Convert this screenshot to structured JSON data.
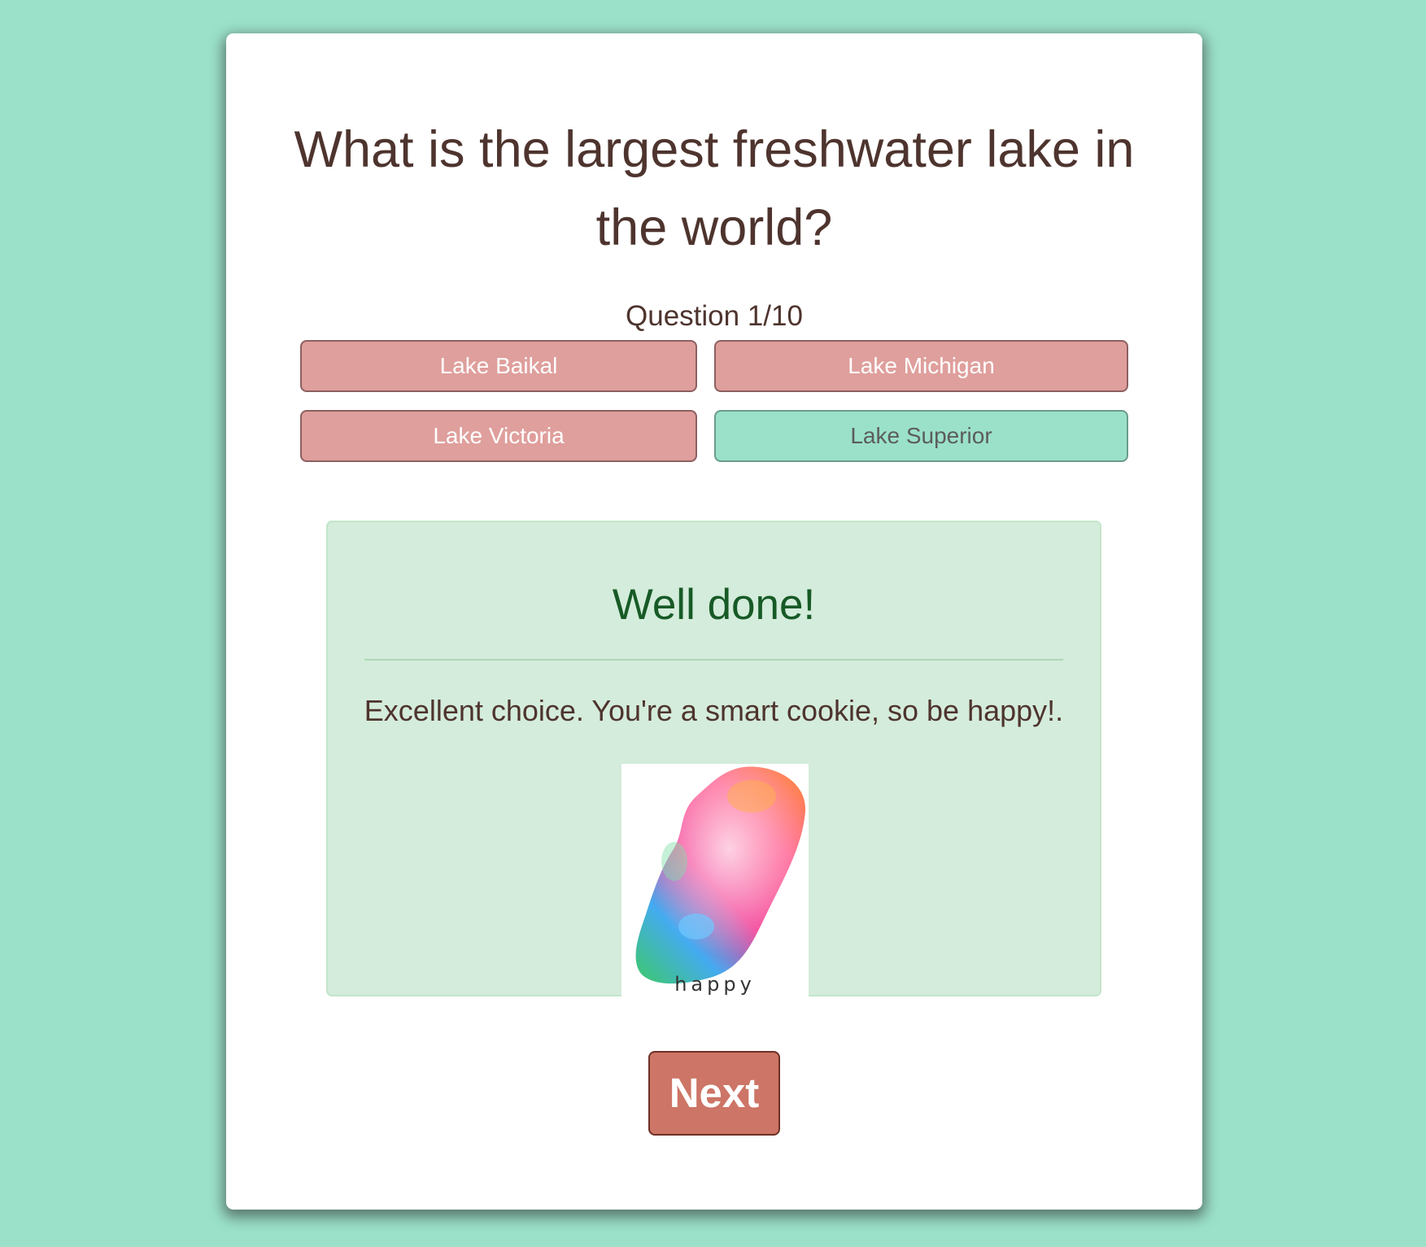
{
  "quiz": {
    "question": "What is the largest freshwater lake in the world?",
    "counter": "Question 1/10",
    "answers": [
      {
        "label": "Lake Baikal",
        "state": "incorrect"
      },
      {
        "label": "Lake Michigan",
        "state": "incorrect"
      },
      {
        "label": "Lake Victoria",
        "state": "incorrect"
      },
      {
        "label": "Lake Superior",
        "state": "correct"
      }
    ]
  },
  "feedback": {
    "title": "Well done!",
    "message": "Excellent choice. You're a smart cookie, so be happy!.",
    "image_caption": "happy"
  },
  "next_label": "Next",
  "colors": {
    "page_background": "#9be1ca",
    "incorrect_answer": "#df9f9c",
    "correct_answer": "#9be1ca",
    "feedback_background": "#d4ecdb",
    "feedback_title": "#175a26",
    "text": "#4e342e",
    "next_button": "#cd7566"
  }
}
